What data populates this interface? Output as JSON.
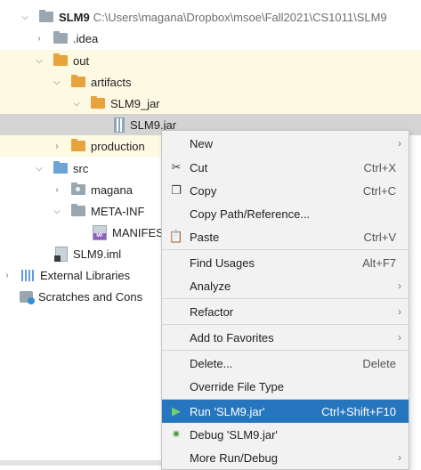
{
  "tree": {
    "root": {
      "name": "SLM9",
      "path": "C:\\Users\\magana\\Dropbox\\msoe\\Fall2021\\CS1011\\SLM9"
    },
    "idea": ".idea",
    "out": "out",
    "artifacts": "artifacts",
    "slm9_jar_dir": "SLM9_jar",
    "slm9_jar_file": "SLM9.jar",
    "production": "production",
    "src": "src",
    "magana": "magana",
    "meta_inf": "META-INF",
    "manifest": "MANIFES",
    "iml": "SLM9.iml",
    "ext_libs": "External Libraries",
    "scratches": "Scratches and Cons"
  },
  "menu": {
    "new": "New",
    "cut": "Cut",
    "cut_sc": "Ctrl+X",
    "copy": "Copy",
    "copy_sc": "Ctrl+C",
    "copy_path": "Copy Path/Reference...",
    "paste": "Paste",
    "paste_sc": "Ctrl+V",
    "find_usages": "Find Usages",
    "find_usages_sc": "Alt+F7",
    "analyze": "Analyze",
    "refactor": "Refactor",
    "add_fav": "Add to Favorites",
    "delete": "Delete...",
    "delete_sc": "Delete",
    "override": "Override File Type",
    "run": "Run 'SLM9.jar'",
    "run_sc": "Ctrl+Shift+F10",
    "debug": "Debug 'SLM9.jar'",
    "more_run": "More Run/Debug"
  },
  "colors": {
    "selection": "#2675bf",
    "folder_orange": "#e8a33c",
    "highlight": "#fdf9e3"
  }
}
